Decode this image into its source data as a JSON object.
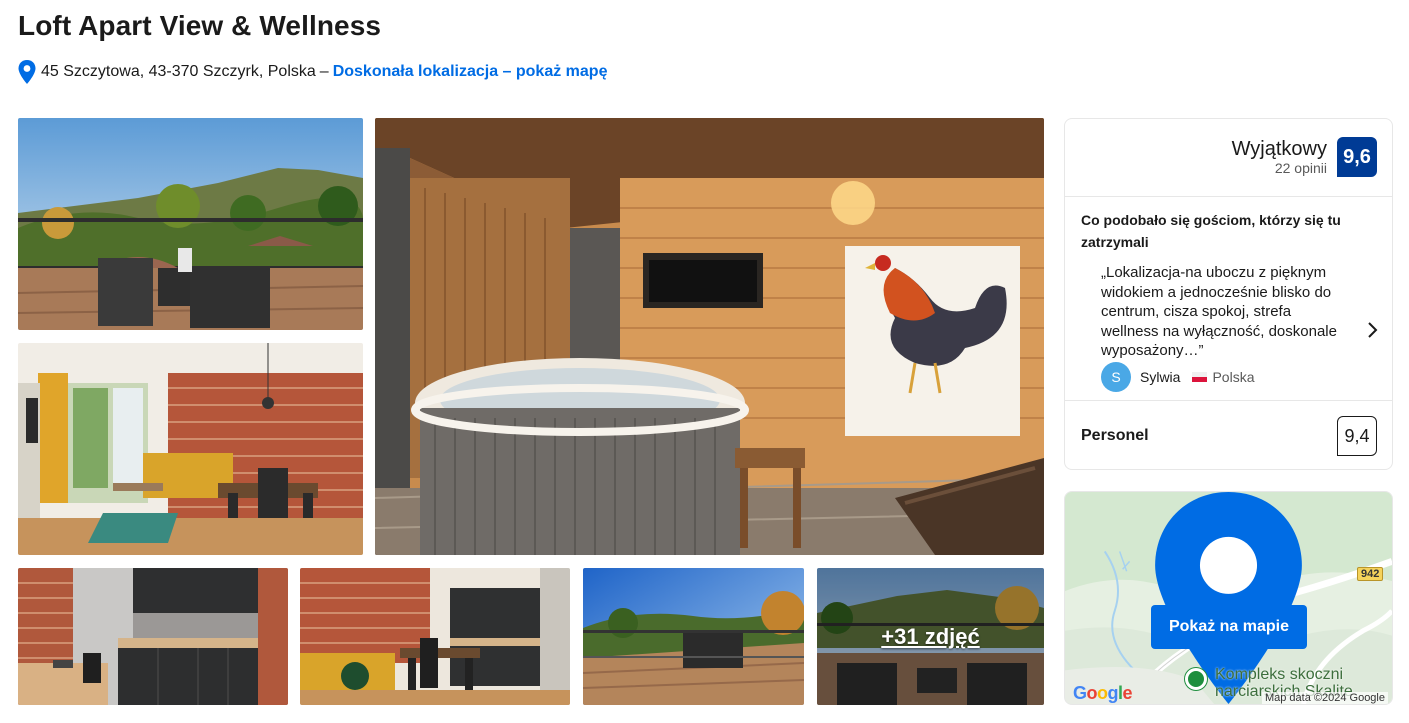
{
  "property": {
    "title": "Loft Apart View & Wellness",
    "address": "45 Szczytowa, 43-370 Szczyrk, Polska",
    "address_separator": "–",
    "location_link": "Doskonała lokalizacja – pokaż mapę"
  },
  "gallery": {
    "more_photos_label": "+31 zdjęć"
  },
  "reviews": {
    "rating_word": "Wyjątkowy",
    "review_count": "22 opinii",
    "score": "9,6",
    "liked_title": "Co podobało się gościom, którzy się tu zatrzymali",
    "quote": "„Lokalizacja-na uboczu z pięknym widokiem a jednocześnie blisko do centrum, cisza spokoj, strefa wellness na wyłączność, doskonale wyposażony…”",
    "reviewer_initial": "S",
    "reviewer_name": "Sylwia",
    "reviewer_country": "Polska",
    "staff_label": "Personel",
    "staff_score": "9,4"
  },
  "map": {
    "button_label": "Pokaż na mapie",
    "road_number": "942",
    "poi_label": "Kompleks skoczni narciarskich Skalite",
    "google_logo": "Google",
    "attribution": "Map data ©2024 Google"
  },
  "colors": {
    "link_blue": "#006ce4",
    "score_badge": "#003b95",
    "google_blue": "#4285f4",
    "google_red": "#ea4335",
    "google_yellow": "#fbbc05",
    "google_green": "#34a853"
  }
}
